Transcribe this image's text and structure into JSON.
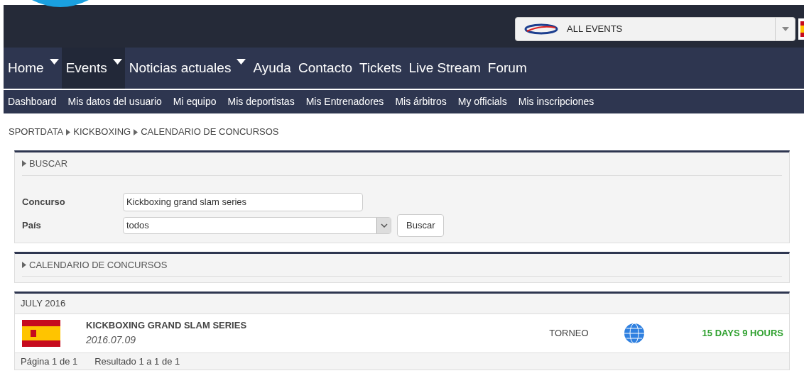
{
  "events_select": {
    "value": "ALL EVENTS"
  },
  "main_nav": [
    {
      "label": "Home",
      "dropdown": true,
      "selected": false
    },
    {
      "label": "Events",
      "dropdown": true,
      "selected": true
    },
    {
      "label": "Noticias actuales",
      "dropdown": true,
      "selected": false
    },
    {
      "label": "Ayuda",
      "dropdown": false,
      "selected": false
    },
    {
      "label": "Contacto",
      "dropdown": false,
      "selected": false
    },
    {
      "label": "Tickets",
      "dropdown": false,
      "selected": false
    },
    {
      "label": "Live Stream",
      "dropdown": false,
      "selected": false
    },
    {
      "label": "Forum",
      "dropdown": false,
      "selected": false
    }
  ],
  "sub_nav": [
    "Dashboard",
    "Mis datos del usuario",
    "Mi equipo",
    "Mis deportistas",
    "Mis Entrenadores",
    "Mis árbitros",
    "My officials",
    "Mis inscripciones"
  ],
  "breadcrumb": [
    "SPORTDATA",
    "KICKBOXING",
    "CALENDARIO DE CONCURSOS"
  ],
  "search_panel": {
    "title": "BUSCAR",
    "fields": [
      {
        "kind": "text",
        "label": "Concurso",
        "value": "Kickboxing grand slam series"
      },
      {
        "kind": "select",
        "label": "País",
        "value": "todos"
      }
    ],
    "button": "Buscar"
  },
  "calendar_panel": {
    "title": "CALENDARIO DE CONCURSOS"
  },
  "month_group": {
    "title": "JULY 2016",
    "events": [
      {
        "name": "KICKBOXING GRAND SLAM SERIES",
        "date": "2016.07.09",
        "type": "TORNEO",
        "countdown": "15 DAYS 9 HOURS"
      }
    ]
  },
  "pagination": {
    "page": "Página 1 de 1",
    "results": "Resultado 1 a 1 de 1"
  }
}
